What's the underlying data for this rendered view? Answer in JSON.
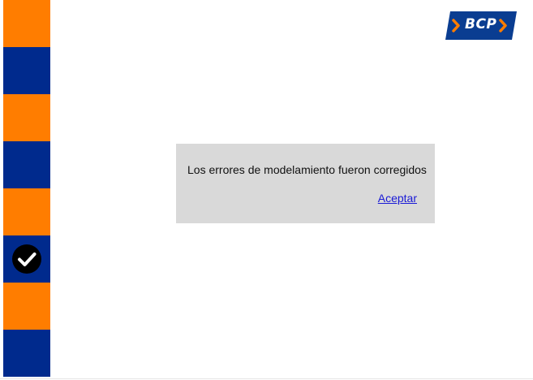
{
  "logo": {
    "text": "›BCP›",
    "colors": {
      "background": "#0a3d91",
      "text": "#ffffff",
      "accent": "#ff7d00"
    }
  },
  "side_strip": {
    "colors": {
      "orange": "#ff7d00",
      "blue": "#002a8d"
    },
    "blocks": [
      "orange",
      "blue",
      "orange",
      "blue",
      "orange",
      "blue-check",
      "orange",
      "blue"
    ],
    "status_icon": "check-circle-icon"
  },
  "dialog": {
    "message": "Los errores de modelamiento fueron corregidos",
    "accept_label": "Aceptar",
    "background": "#d9d9d9",
    "link_color": "#1a1ad6"
  }
}
